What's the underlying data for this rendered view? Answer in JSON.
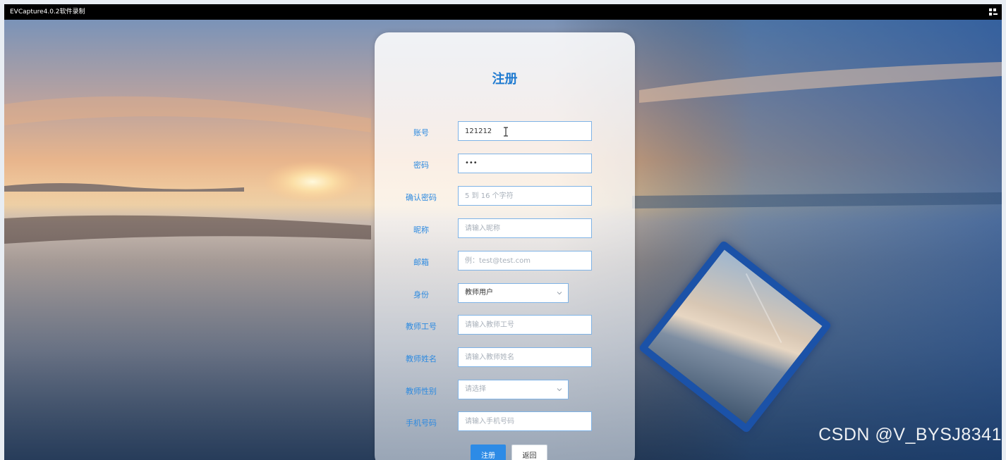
{
  "window": {
    "title": "EVCapture4.0.2软件录制",
    "menu_icon": "grid-menu-icon"
  },
  "form": {
    "heading": "注册",
    "fields": [
      {
        "label": "账号",
        "value": "121212",
        "placeholder": ""
      },
      {
        "label": "密码",
        "value": "•••",
        "placeholder": ""
      },
      {
        "label": "确认密码",
        "value": "",
        "placeholder": "5 到 16 个字符"
      },
      {
        "label": "昵称",
        "value": "",
        "placeholder": "请输入昵称"
      },
      {
        "label": "邮箱",
        "value": "",
        "placeholder": "例：test@test.com"
      },
      {
        "label": "身份",
        "selected": "教师用户"
      },
      {
        "label": "教师工号",
        "value": "",
        "placeholder": "请输入教师工号"
      },
      {
        "label": "教师姓名",
        "value": "",
        "placeholder": "请输入教师姓名"
      },
      {
        "label": "教师性别",
        "selected": "请选择"
      },
      {
        "label": "手机号码",
        "value": "",
        "placeholder": "请输入手机号码"
      }
    ],
    "register_button": "注册",
    "back_button": "返回"
  },
  "watermark": "CSDN @V_BYSJ8341",
  "colors": {
    "accent": "#2d8be6",
    "label": "#2d8ae0",
    "heading": "#1f7ad0",
    "field_border": "#7fb3e6"
  }
}
